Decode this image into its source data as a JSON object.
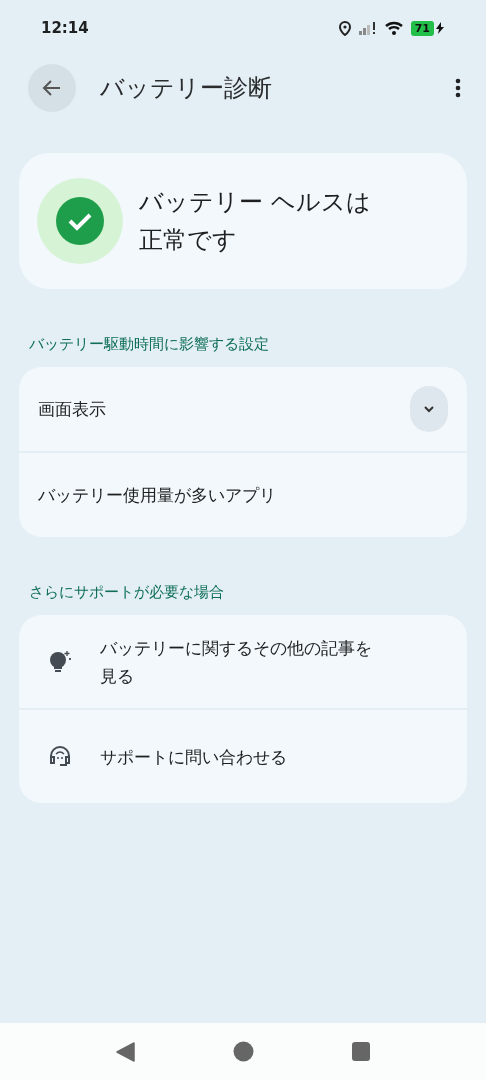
{
  "status_bar": {
    "time": "12:14",
    "battery": "71"
  },
  "app_bar": {
    "title": "バッテリー診断"
  },
  "health_card": {
    "text": "バッテリー ヘルスは正常です"
  },
  "sections": [
    {
      "heading": "バッテリー駆動時間に影響する設定",
      "items": [
        {
          "kind": "expandable",
          "label": "画面表示",
          "expanded": false
        },
        {
          "kind": "plain",
          "label": "バッテリー使用量が多いアプリ"
        }
      ]
    },
    {
      "heading": "さらにサポートが必要な場合",
      "items": [
        {
          "kind": "article",
          "label": "バッテリーに関するその他の記事を見る"
        },
        {
          "kind": "contact",
          "label": "サポートに問い合わせる"
        }
      ]
    }
  ]
}
